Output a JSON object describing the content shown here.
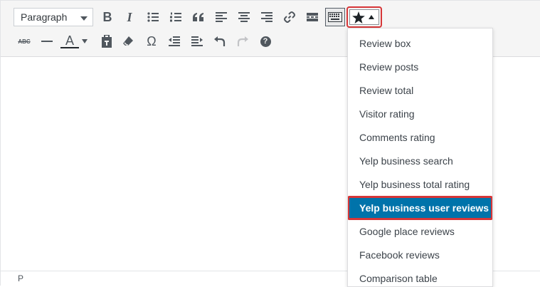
{
  "toolbar": {
    "format_select": {
      "value": "Paragraph"
    },
    "row1_icons": [
      "bold-icon",
      "italic-icon",
      "bullet-list-icon",
      "numbered-list-icon",
      "blockquote-icon",
      "align-left-icon",
      "align-center-icon",
      "align-right-icon",
      "link-icon",
      "read-more-icon",
      "keyboard-icon"
    ],
    "row2_icons": [
      "strikethrough-icon",
      "horizontal-line-icon",
      "text-color-icon",
      "paste-text-icon",
      "clear-formatting-icon",
      "special-character-icon",
      "outdent-icon",
      "indent-icon",
      "undo-icon",
      "redo-icon",
      "help-icon"
    ],
    "bold_label": "B",
    "italic_label": "I",
    "strike_label": "ABC",
    "text_color_label": "A",
    "omega_label": "Ω",
    "help_label": "?",
    "highlight_color": "#d63638"
  },
  "dropdown": {
    "items": [
      "Review box",
      "Review posts",
      "Review total",
      "Visitor rating",
      "Comments rating",
      "Yelp business search",
      "Yelp business total rating",
      "Yelp business user reviews",
      "Google place reviews",
      "Facebook reviews",
      "Comparison table"
    ],
    "selected": "Yelp business user reviews",
    "selected_bg": "#0073aa"
  },
  "statusbar": {
    "path": "P"
  }
}
